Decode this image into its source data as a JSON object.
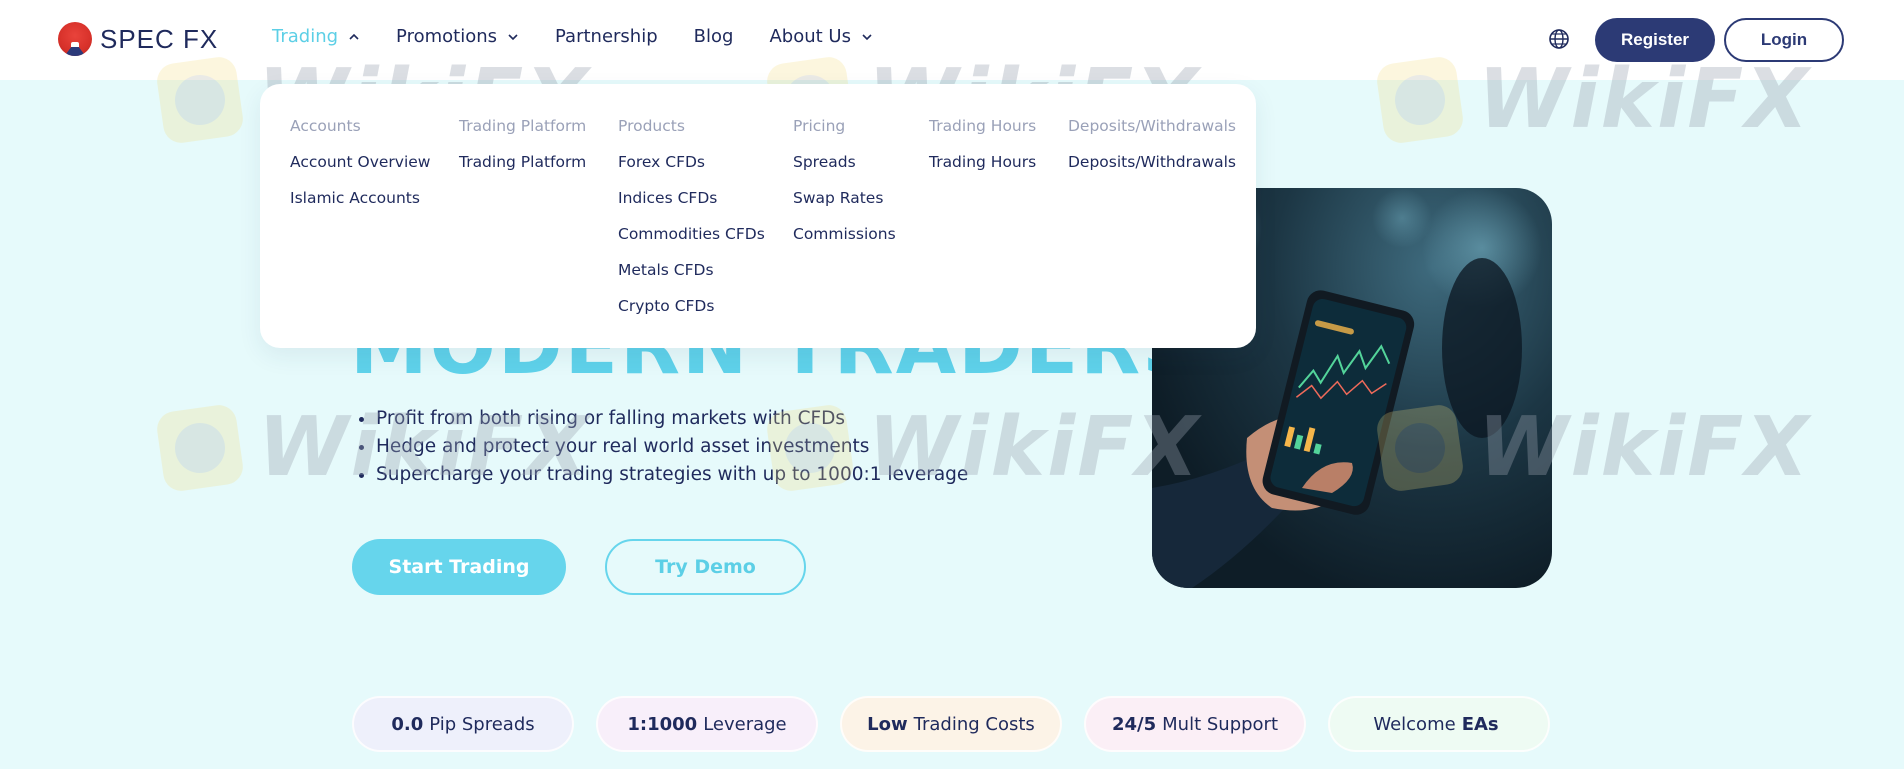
{
  "brand": {
    "name": "SPEC FX"
  },
  "nav": {
    "items": [
      {
        "label": "Trading",
        "active": true,
        "has_dropdown": true
      },
      {
        "label": "Promotions",
        "has_dropdown": true
      },
      {
        "label": "Partnership",
        "has_dropdown": false
      },
      {
        "label": "Blog",
        "has_dropdown": false
      },
      {
        "label": "About Us",
        "has_dropdown": true
      }
    ],
    "register_label": "Register",
    "login_label": "Login"
  },
  "dropdown": {
    "columns": [
      {
        "heading": "Accounts",
        "links": [
          "Account Overview",
          "Islamic Accounts"
        ]
      },
      {
        "heading": "Trading Platform",
        "links": [
          "Trading Platform"
        ]
      },
      {
        "heading": "Products",
        "links": [
          "Forex CFDs",
          "Indices CFDs",
          "Commodities CFDs",
          "Metals CFDs",
          "Crypto CFDs"
        ]
      },
      {
        "heading": "Pricing",
        "links": [
          "Spreads",
          "Swap Rates",
          "Commissions"
        ]
      },
      {
        "heading": "Trading Hours",
        "links": [
          "Trading Hours"
        ]
      },
      {
        "heading": "Deposits/Withdrawals",
        "links": [
          "Deposits/Withdrawals"
        ]
      }
    ]
  },
  "hero": {
    "headline_partial": "MODERN TRADERS",
    "bullets": [
      "Profit from both rising or falling markets with CFDs",
      "Hedge and protect your real world asset investments",
      "Supercharge your trading strategies with up to 1000:1 leverage"
    ],
    "start_label": "Start Trading",
    "demo_label": "Try Demo"
  },
  "features": [
    {
      "bold": "0.0",
      "text": "Pip Spreads",
      "bg": "#eef0fb"
    },
    {
      "bold": "1:1000",
      "text": "Leverage",
      "bg": "#f8effa"
    },
    {
      "bold": "Low",
      "text": "Trading Costs",
      "bg": "#fcf3e7"
    },
    {
      "bold": "24/5",
      "text": "Mult Support",
      "bg": "#fbeff6"
    },
    {
      "prefix": "Welcome",
      "bold_after": "EAs",
      "bg": "#eefbf3"
    }
  ],
  "watermark": {
    "text": "WikiFX"
  },
  "colors": {
    "accent": "#5ccfe6",
    "navy": "#2c3a75",
    "page_bg": "#e6fafb"
  }
}
